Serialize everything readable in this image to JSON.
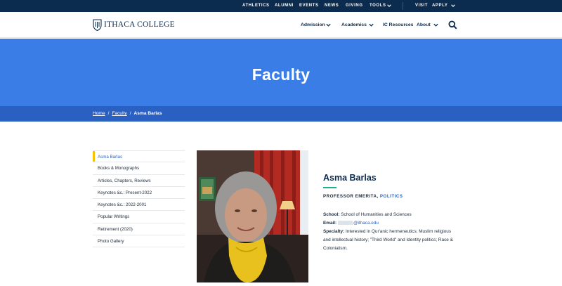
{
  "utility_bar": {
    "links": [
      "ATHLETICS",
      "ALUMNI",
      "EVENTS",
      "NEWS",
      "GIVING",
      "TOOLS"
    ],
    "visit": "VISIT",
    "apply": "APPLY"
  },
  "header": {
    "logo_text": "ITHACA COLLEGE",
    "nav": [
      "Admission",
      "Academics",
      "IC Resources",
      "About"
    ]
  },
  "hero": {
    "title": "Faculty"
  },
  "breadcrumb": {
    "home": "Home",
    "section": "Faculty",
    "current": "Asma Barlas"
  },
  "sidebar": {
    "items": [
      "Asma Barlas",
      "Books & Monographs",
      "Articles, Chapters, Reviews",
      "Keynotes &c.: Present-2022",
      "Keynotes &c.: 2022-2001",
      "Popular Writings",
      "Retirement (2020)",
      "Photo Gallery"
    ]
  },
  "profile": {
    "name": "Asma Barlas",
    "title": "PROFESSOR EMERITA,",
    "department": "POLITICS",
    "school_label": "School:",
    "school_value": "School of Humanities and Sciences",
    "email_label": "Email:",
    "email_value": "@ithaca.edu",
    "specialty_label": "Specialty:",
    "specialty_value": "Interested in Qur'anic hermeneutics; Muslim religious and intellectual history; \"Third World\" and Identity politics; Race & Colonialism."
  },
  "colors": {
    "navy": "#0b2b4f",
    "hero_blue": "#3b7de7",
    "breadcrumb_blue": "#2b60c3",
    "accent_yellow": "#f5c400",
    "accent_green": "#1fb28a"
  }
}
